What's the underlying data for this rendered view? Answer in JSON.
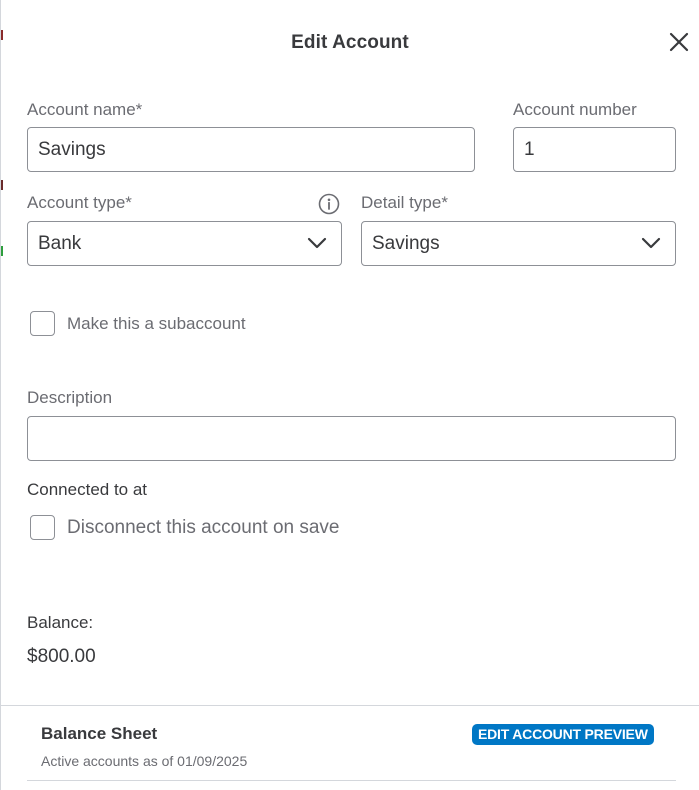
{
  "dialog": {
    "title": "Edit Account"
  },
  "form": {
    "account_name": {
      "label": "Account name*",
      "value": "Savings"
    },
    "account_number": {
      "label": "Account number",
      "value": "1"
    },
    "account_type": {
      "label": "Account type*",
      "value": "Bank"
    },
    "detail_type": {
      "label": "Detail type*",
      "value": "Savings"
    },
    "subaccount": {
      "label": "Make this a subaccount",
      "checked": false
    },
    "description": {
      "label": "Description",
      "value": ""
    },
    "connection": {
      "label": "Connected to at",
      "disconnect_label": "Disconnect this account on save",
      "checked": false
    }
  },
  "balance": {
    "label": "Balance:",
    "value": "$800.00"
  },
  "balance_sheet": {
    "title": "Balance Sheet",
    "subtitle": "Active accounts as of 01/09/2025",
    "badge": "EDIT ACCOUNT PREVIEW"
  },
  "icons": {
    "close": "close-icon",
    "info": "info-icon",
    "chevron": "chevron-down-icon"
  },
  "colors": {
    "text": "#393a3d",
    "muted": "#6b6c72",
    "border": "#8d9096",
    "accent": "#0077c5",
    "divider": "#d4d7dc"
  }
}
